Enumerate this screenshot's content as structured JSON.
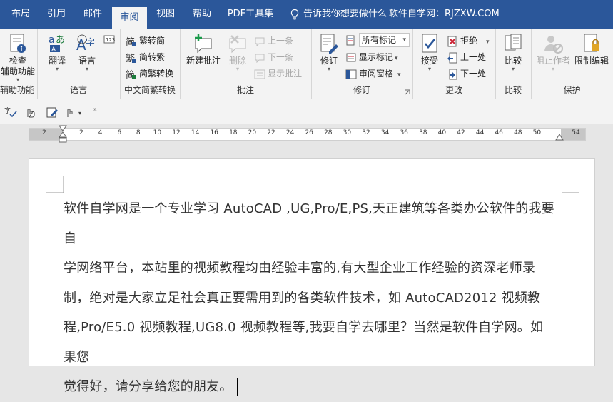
{
  "tabs": [
    {
      "label": "布局"
    },
    {
      "label": "引用"
    },
    {
      "label": "邮件"
    },
    {
      "label": "审阅"
    },
    {
      "label": "视图"
    },
    {
      "label": "帮助"
    },
    {
      "label": "PDF工具集"
    }
  ],
  "tell_me": "告诉我你想要做什么",
  "site_label": "软件自学网：RJZXW.COM",
  "ribbon": {
    "accessibility": {
      "line1": "检查",
      "line2": "辅助功能",
      "group": "辅助功能"
    },
    "language": {
      "translate": "翻译",
      "language": "语言",
      "group": "语言"
    },
    "chinese": {
      "t2s": "繁转简",
      "s2t": "简转繁",
      "convert": "简繁转换",
      "group": "中文简繁转换"
    },
    "comments": {
      "new": "新建批注",
      "delete": "删除",
      "prev": "上一条",
      "next": "下一条",
      "show": "显示批注",
      "group": "批注"
    },
    "tracking": {
      "track": "修订",
      "markup_select": "所有标记",
      "show_markup": "显示标记",
      "reviewing_pane": "审阅窗格",
      "group": "修订"
    },
    "changes": {
      "accept": "接受",
      "reject": "拒绝",
      "prev": "上一处",
      "next": "下一处",
      "group": "更改"
    },
    "compare": {
      "compare": "比较",
      "group": "比较"
    },
    "protect": {
      "block_authors": "阻止作者",
      "restrict": "限制编辑",
      "group": "保护"
    }
  },
  "ruler": {
    "left_label": "2",
    "numbers": [
      "2",
      "4",
      "6",
      "8",
      "10",
      "12",
      "14",
      "16",
      "18",
      "20",
      "22",
      "24",
      "26",
      "28",
      "30",
      "32",
      "34",
      "36",
      "38",
      "40",
      "42",
      "44",
      "46",
      "48",
      "50"
    ],
    "right_label": "54"
  },
  "document": {
    "lines": [
      "软件自学网是一个专业学习 AutoCAD ,UG,Pro/E,PS,天正建筑等各类办公软件的我要自",
      "学网络平台，本站里的视频教程均由经验丰富的,有大型企业工作经验的资深老师录",
      "制，绝对是大家立足社会真正要需用到的各类软件技术，如 AutoCAD2012 视频教",
      "程,Pro/E5.0 视频教程,UG8.0 视频教程等,我要自学去哪里？当然是软件自学网。如果您",
      "觉得好，请分享给您的朋友。"
    ]
  },
  "colors": {
    "accent": "#2b579a",
    "ribbon_bg": "#f3f3f3",
    "workspace": "#e6e6e6"
  }
}
